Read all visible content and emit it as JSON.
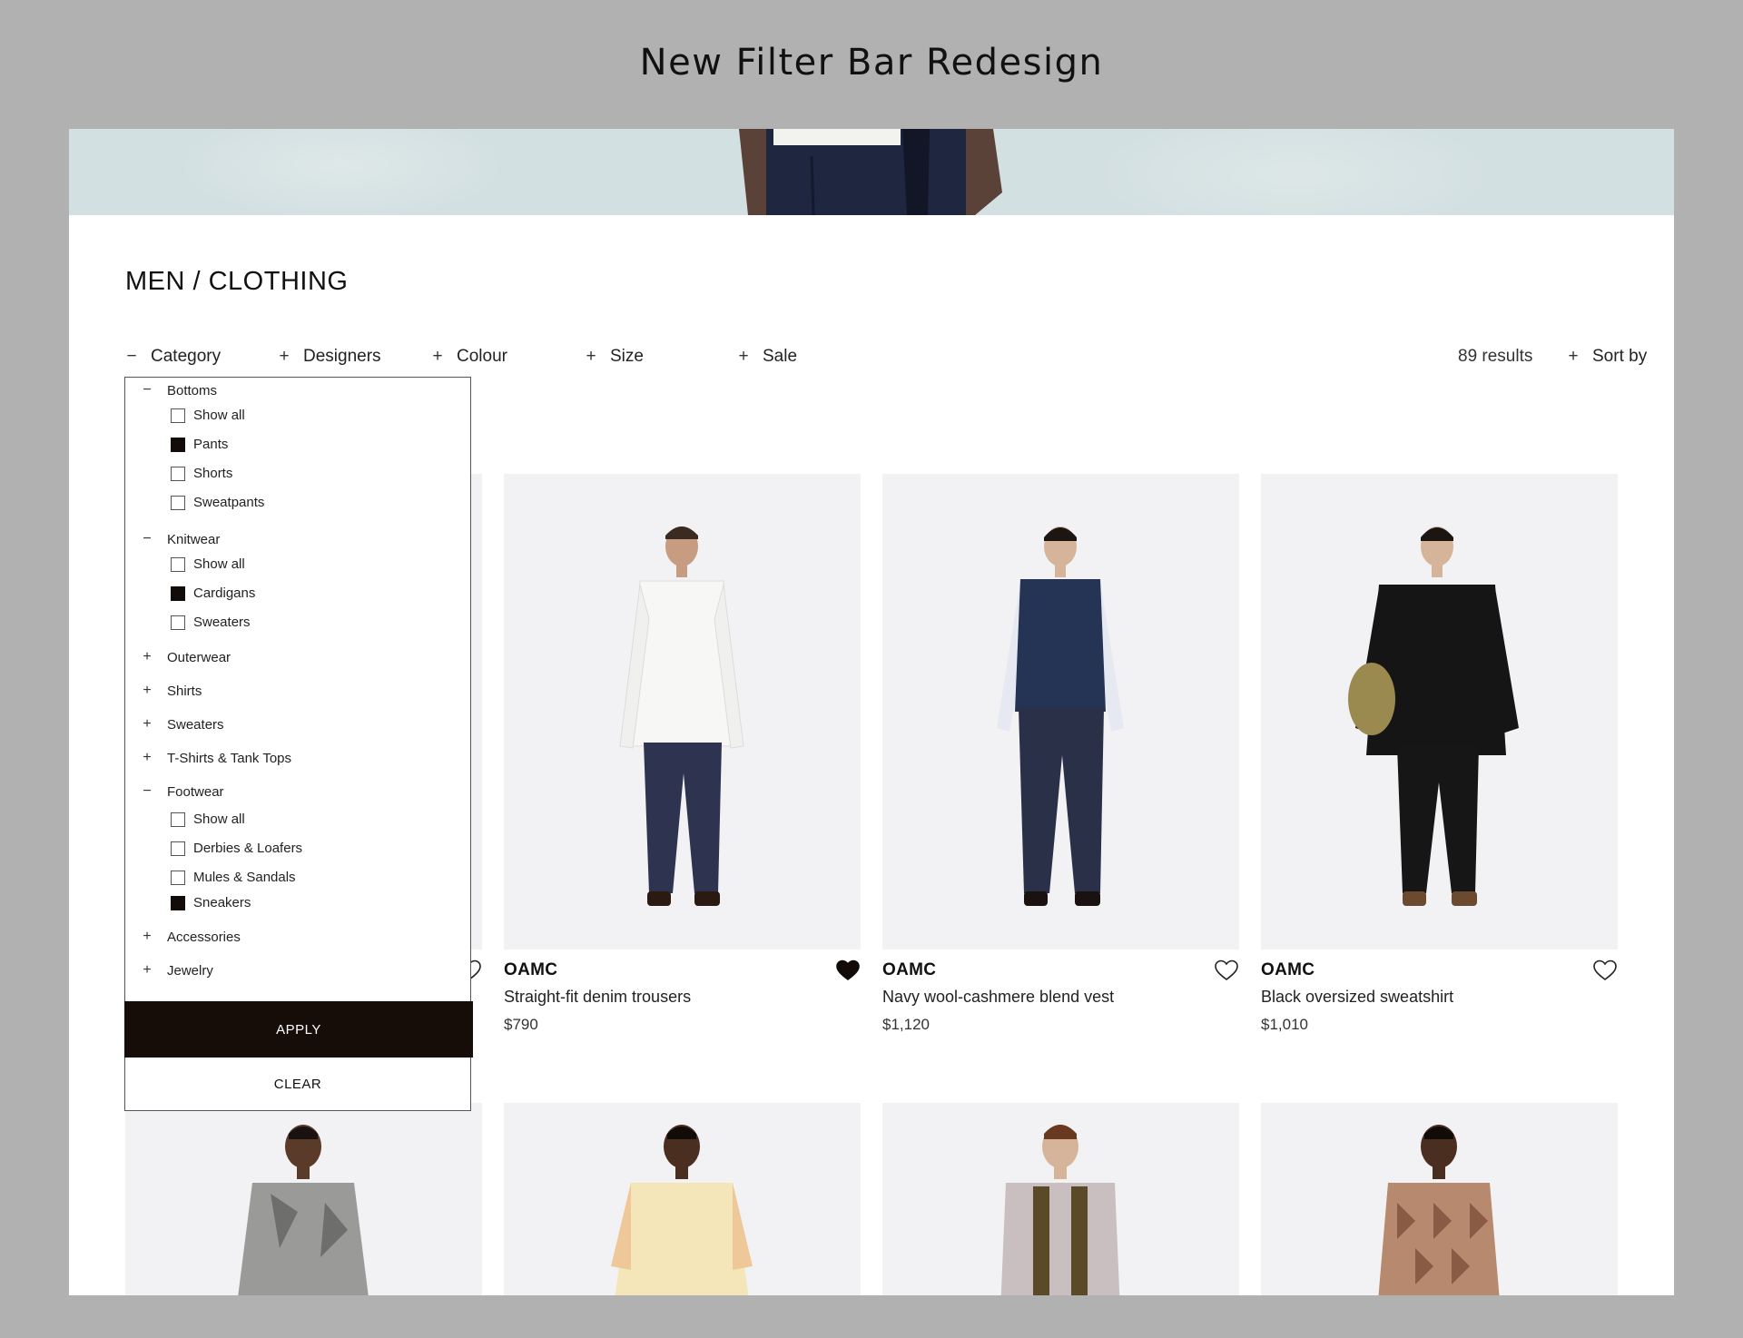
{
  "page_heading": "New Filter Bar Redesign",
  "breadcrumb": "MEN / CLOTHING",
  "filters": [
    {
      "label": "Category",
      "state": "−"
    },
    {
      "label": "Designers",
      "state": "+"
    },
    {
      "label": "Colour",
      "state": "+"
    },
    {
      "label": "Size",
      "state": "+"
    },
    {
      "label": "Sale",
      "state": "+"
    }
  ],
  "results": "89 results",
  "sort": {
    "label": "Sort by",
    "state": "+"
  },
  "category_panel": {
    "groups": [
      {
        "label": "Bottoms",
        "state": "−"
      },
      {
        "label": "Knitwear",
        "state": "−"
      },
      {
        "label": "Outerwear",
        "state": "+"
      },
      {
        "label": "Shirts",
        "state": "+"
      },
      {
        "label": "Sweaters",
        "state": "+"
      },
      {
        "label": "T-Shirts & Tank Tops",
        "state": "+"
      },
      {
        "label": "Footwear",
        "state": "−"
      },
      {
        "label": "Accessories",
        "state": "+"
      },
      {
        "label": "Jewelry",
        "state": "+"
      }
    ],
    "options": [
      {
        "label": "Show all",
        "checked": false
      },
      {
        "label": "Pants",
        "checked": true
      },
      {
        "label": "Shorts",
        "checked": false
      },
      {
        "label": "Sweatpants",
        "checked": false
      },
      {
        "label": "Show all",
        "checked": false
      },
      {
        "label": "Cardigans",
        "checked": true
      },
      {
        "label": "Sweaters",
        "checked": false
      },
      {
        "label": "Show all",
        "checked": false
      },
      {
        "label": "Derbies & Loafers",
        "checked": false
      },
      {
        "label": "Mules & Sandals",
        "checked": false
      },
      {
        "label": "Sneakers",
        "checked": true
      }
    ],
    "apply_label": "APPLY",
    "clear_label": "CLEAR"
  },
  "products": [
    {
      "brand": "OAMC",
      "name": "Straight-fit denim trousers",
      "price": "$790",
      "favorited": true,
      "top_color": "#f7f7f5",
      "bottom_color": "#2e3450"
    },
    {
      "brand": "OAMC",
      "name": "Navy wool-cashmere blend vest",
      "price": "$1,120",
      "favorited": false,
      "top_color": "#253454",
      "bottom_color": "#2a3048"
    },
    {
      "brand": "OAMC",
      "name": "Black oversized sweatshirt",
      "price": "$1,010",
      "favorited": false,
      "top_color": "#151515",
      "bottom_color": "#161616"
    }
  ],
  "row2_products": [
    {
      "top_color": "#9a9a98"
    },
    {
      "top_color": "#f4e6b8"
    },
    {
      "top_color": "#c9bfc0"
    },
    {
      "top_color": "#b78a70"
    }
  ],
  "colors": {
    "background": "#b1b1b1",
    "hero": "#d3e0e1",
    "apply": "#170d08",
    "card_bg": "#f2f2f4"
  }
}
